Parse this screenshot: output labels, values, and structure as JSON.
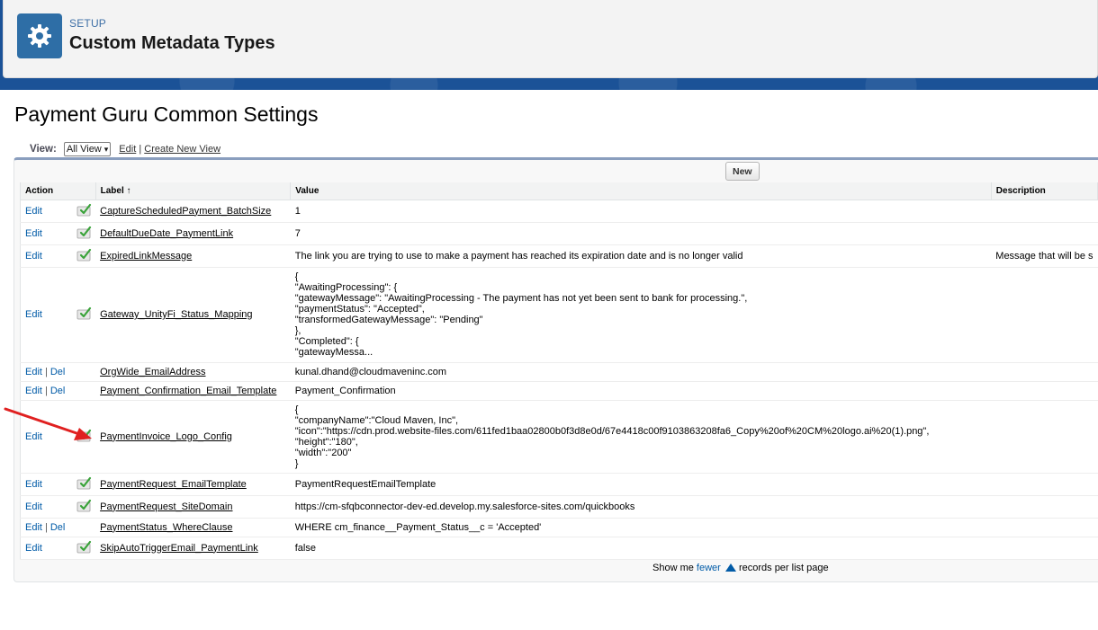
{
  "header": {
    "setup_label": "SETUP",
    "title": "Custom Metadata Types"
  },
  "object_title": "Payment Guru Common Settings",
  "view": {
    "label": "View:",
    "selected": "All View",
    "edit_link": "Edit",
    "separator": "|",
    "create_link": "Create New View"
  },
  "new_button": "New",
  "columns": {
    "action": "Action",
    "label": "Label",
    "sort_indicator": "↑",
    "value": "Value",
    "description": "Description"
  },
  "rows": [
    {
      "actions": [
        "Edit"
      ],
      "checked": true,
      "label": "CaptureScheduledPayment_BatchSize",
      "value": "1",
      "description": ""
    },
    {
      "actions": [
        "Edit"
      ],
      "checked": true,
      "label": "DefaultDueDate_PaymentLink",
      "value": "7",
      "description": ""
    },
    {
      "actions": [
        "Edit"
      ],
      "checked": true,
      "label": "ExpiredLinkMessage",
      "value": "The link you are trying to use to make a payment has reached its expiration date and is no longer valid",
      "description": "Message that will be s"
    },
    {
      "actions": [
        "Edit"
      ],
      "checked": true,
      "label": "Gateway_UnityFi_Status_Mapping",
      "value": "{\n\"AwaitingProcessing\": {\n\"gatewayMessage\": \"AwaitingProcessing - The payment has not yet been sent to bank for processing.\",\n\"paymentStatus\": \"Accepted\",\n\"transformedGatewayMessage\": \"Pending\"\n},\n\"Completed\": {\n\"gatewayMessa...",
      "description": ""
    },
    {
      "actions": [
        "Edit",
        "Del"
      ],
      "checked": false,
      "label": "OrgWide_EmailAddress",
      "value": "kunal.dhand@cloudmaveninc.com",
      "description": ""
    },
    {
      "actions": [
        "Edit",
        "Del"
      ],
      "checked": false,
      "label": "Payment_Confirmation_Email_Template",
      "value": "Payment_Confirmation",
      "description": ""
    },
    {
      "actions": [
        "Edit"
      ],
      "checked": true,
      "label": "PaymentInvoice_Logo_Config",
      "value": "{\n\"companyName\":\"Cloud Maven, Inc\",\n\"icon\":\"https://cdn.prod.website-files.com/611fed1baa02800b0f3d8e0d/67e4418c00f9103863208fa6_Copy%20of%20CM%20logo.ai%20(1).png\",\n\"height\":\"180\",\n\"width\":\"200\"\n}",
      "description": ""
    },
    {
      "actions": [
        "Edit"
      ],
      "checked": true,
      "label": "PaymentRequest_EmailTemplate",
      "value": "PaymentRequestEmailTemplate",
      "description": ""
    },
    {
      "actions": [
        "Edit"
      ],
      "checked": true,
      "label": "PaymentRequest_SiteDomain",
      "value": "https://cm-sfqbconnector-dev-ed.develop.my.salesforce-sites.com/quickbooks",
      "description": ""
    },
    {
      "actions": [
        "Edit",
        "Del"
      ],
      "checked": false,
      "label": "PaymentStatus_WhereClause",
      "value": "WHERE cm_finance__Payment_Status__c = 'Accepted'",
      "description": ""
    },
    {
      "actions": [
        "Edit"
      ],
      "checked": true,
      "label": "SkipAutoTriggerEmail_PaymentLink",
      "value": "false",
      "description": ""
    }
  ],
  "pager": {
    "prefix": "Show me",
    "link": "fewer",
    "suffix": "records per list page"
  },
  "colors": {
    "header_band": "#1b5297",
    "setup_icon_bg": "#2e6ea6",
    "link": "#015ba7",
    "arrow": "#e02020"
  }
}
